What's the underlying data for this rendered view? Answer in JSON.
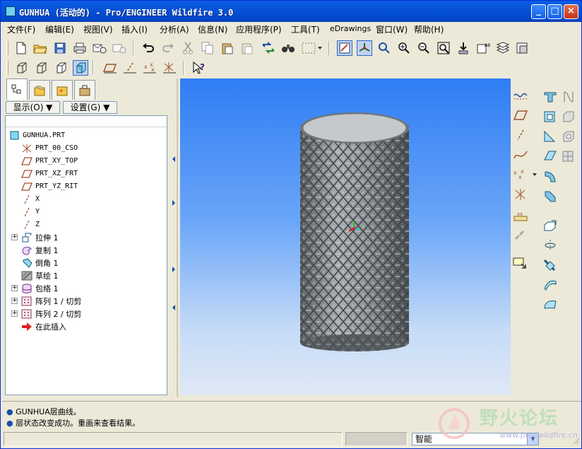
{
  "window": {
    "title": "GUNHUA (活动的) - Pro/ENGINEER Wildfire 3.0",
    "buttons": {
      "minimize": "_",
      "maximize": "□",
      "close": "×"
    }
  },
  "menubar": [
    "文件(F)",
    "编辑(E)",
    "视图(V)",
    "插入(I)",
    "分析(A)",
    "信息(N)",
    "应用程序(P)",
    "工具(T)",
    "eDrawings",
    "窗口(W)",
    "帮助(H)"
  ],
  "toolbar": {
    "row1_icons": [
      "new-file-icon",
      "open-folder-icon",
      "save-icon",
      "print-icon",
      "email-icon",
      "email-link-icon",
      "undo-icon",
      "redo-icon",
      "cut-icon",
      "copy-icon",
      "paste-icon",
      "paste-special-icon",
      "regenerate-icon",
      "find-icon",
      "selection-box-icon",
      "repaint-icon",
      "spin-center-icon",
      "orient-icon",
      "zoom-in-icon",
      "zoom-out-icon",
      "refit-icon",
      "reorient-icon",
      "saved-views-icon",
      "layers-icon",
      "view-manager-icon"
    ],
    "row2_icons": [
      "wireframe-icon",
      "hidden-line-icon",
      "no-hidden-icon",
      "shading-icon",
      "datum-planes-icon",
      "datum-axes-icon",
      "datum-points-icon",
      "coord-sys-icon",
      "context-help-icon"
    ]
  },
  "left_panel": {
    "tabs": [
      "model-tree-tab",
      "folder-browser-tab",
      "favorites-tab",
      "connections-tab"
    ],
    "show_button": "显示(O) ▼",
    "settings_button": "设置(G) ▼",
    "tree_items": [
      {
        "label": "GUNHUA.PRT",
        "icon": "part-icon",
        "expandable": false
      },
      {
        "label": "PRT_00_CSO",
        "icon": "coordinate-system-icon",
        "expandable": false
      },
      {
        "label": "PRT_XY_TOP",
        "icon": "datum-plane-icon",
        "expandable": false
      },
      {
        "label": "PRT_XZ_FRT",
        "icon": "datum-plane-icon",
        "expandable": false
      },
      {
        "label": "PRT_YZ_RIT",
        "icon": "datum-plane-icon",
        "expandable": false
      },
      {
        "label": "X",
        "icon": "datum-axis-icon",
        "expandable": false
      },
      {
        "label": "Y",
        "icon": "datum-axis-icon",
        "expandable": false
      },
      {
        "label": "Z",
        "icon": "datum-axis-icon",
        "expandable": false
      },
      {
        "label": "拉伸 1",
        "icon": "extrude-icon",
        "expandable": true
      },
      {
        "label": "复制 1",
        "icon": "copy-feature-icon",
        "expandable": false
      },
      {
        "label": "倒角 1",
        "icon": "chamfer-icon",
        "expandable": false
      },
      {
        "label": "草绘 1",
        "icon": "sketch-icon",
        "expandable": false
      },
      {
        "label": "包络 1",
        "icon": "wrap-icon",
        "expandable": true
      },
      {
        "label": "阵列 1 / 切剪",
        "icon": "pattern-icon",
        "expandable": true
      },
      {
        "label": "阵列 2 / 切剪",
        "icon": "pattern-icon",
        "expandable": true
      },
      {
        "label": "在此插入",
        "icon": "insert-here-arrow-icon",
        "expandable": false
      }
    ]
  },
  "messages": [
    "GUNHUA层曲线。",
    "层状态改变成功。重画来查看结果。"
  ],
  "statusbar": {
    "filter_value": "智能"
  },
  "watermark": {
    "text": "野火论坛",
    "url": "www.proewildfire.cn"
  },
  "colors": {
    "title_bar": "#0653d8",
    "viewport_top": "#2f7df5",
    "viewport_bottom": "#dfe8f6",
    "model_gray": "#8e9498",
    "datum_plane": "#a0522d"
  }
}
